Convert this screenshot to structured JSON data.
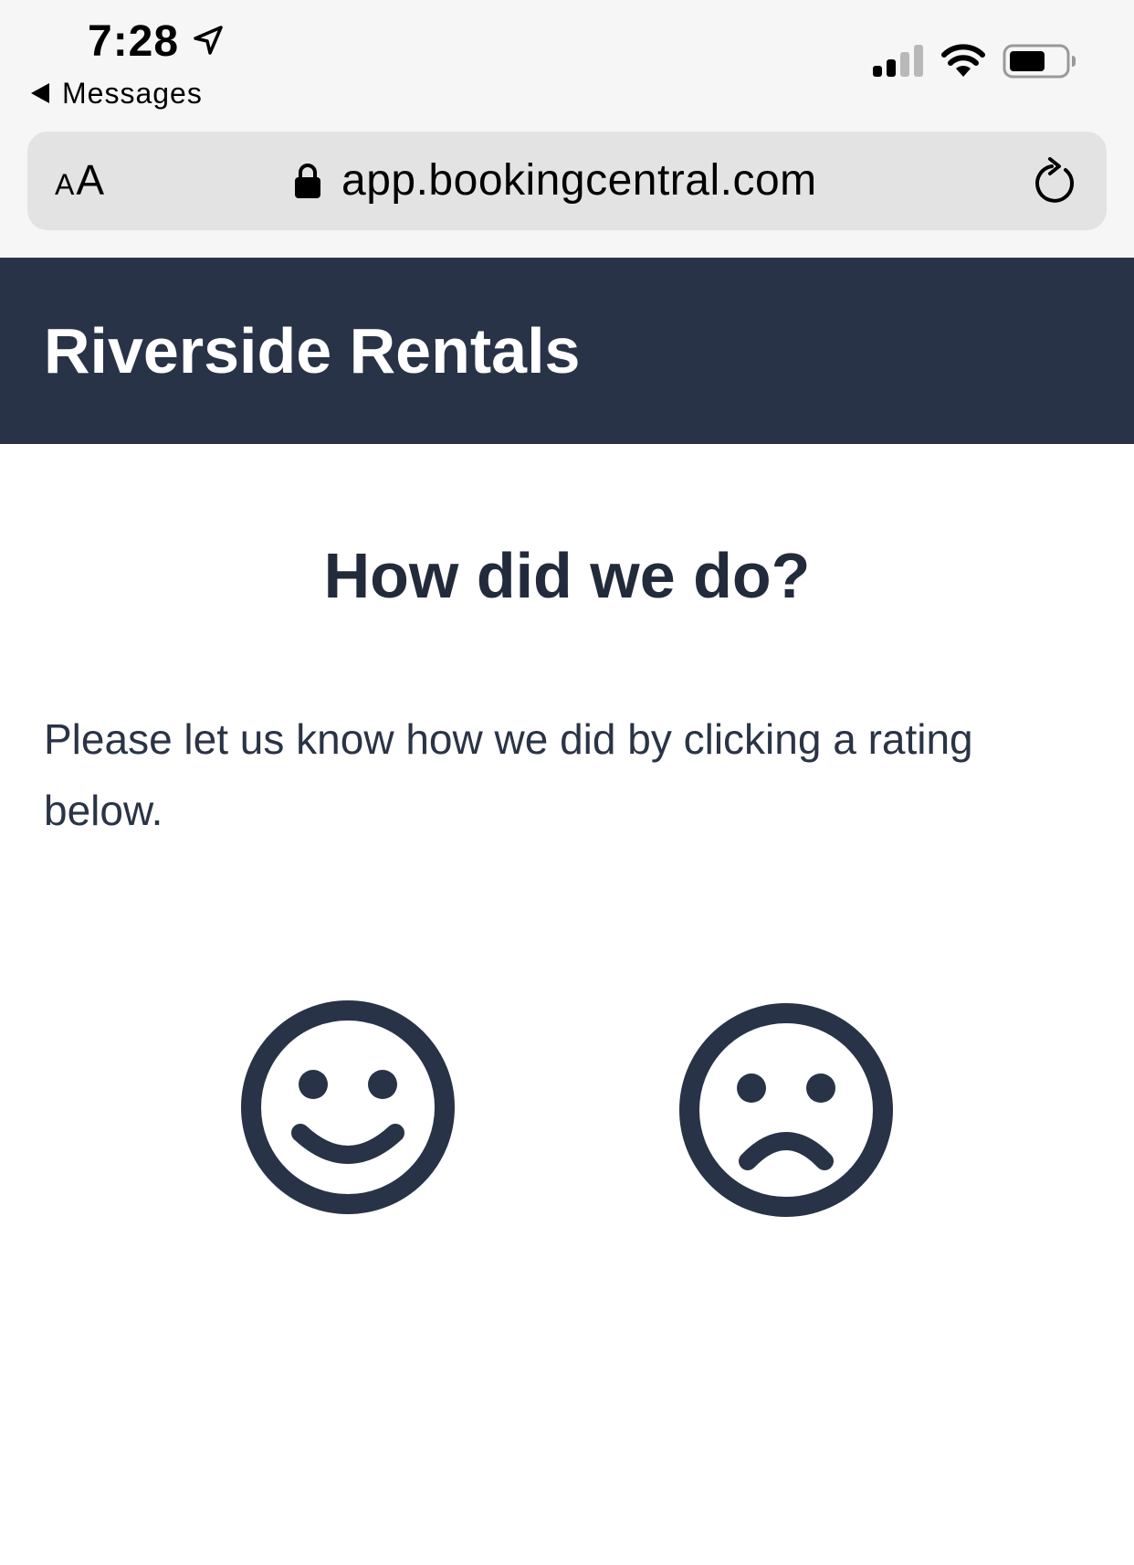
{
  "status_bar": {
    "time": "7:28",
    "back_app_label": "Messages",
    "icons": [
      "location-arrow-icon",
      "cellular-signal-icon",
      "wifi-icon",
      "battery-icon"
    ]
  },
  "browser": {
    "text_size_small": "A",
    "text_size_large": "A",
    "url": "app.bookingcentral.com",
    "icons": [
      "lock-icon",
      "reload-icon"
    ]
  },
  "site": {
    "title": "Riverside Rentals",
    "header_color": "#283347"
  },
  "feedback": {
    "heading": "How did we do?",
    "instruction": "Please let us know how we did by clicking a rating below.",
    "ratings": [
      {
        "icon": "smiley-face-icon"
      },
      {
        "icon": "sad-face-icon"
      }
    ],
    "icon_color": "#283347"
  }
}
